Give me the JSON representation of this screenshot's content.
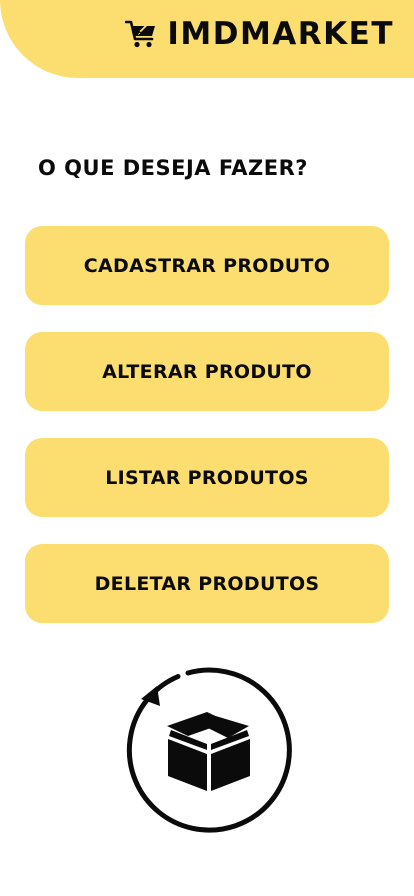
{
  "header": {
    "brand_name": "IMDMARKET",
    "logo_icon": "shopping-cart-rocket-icon",
    "bg_color": "#fcde70"
  },
  "main": {
    "prompt": "O QUE DESEJA FAZER?",
    "actions": [
      {
        "label": "CADASTRAR PRODUTO"
      },
      {
        "label": "ALTERAR PRODUTO"
      },
      {
        "label": "LISTAR PRODUTOS"
      },
      {
        "label": "DELETAR PRODUTOS"
      }
    ],
    "button_color": "#fcde70"
  },
  "illustration": {
    "icon": "box-refresh-icon"
  }
}
